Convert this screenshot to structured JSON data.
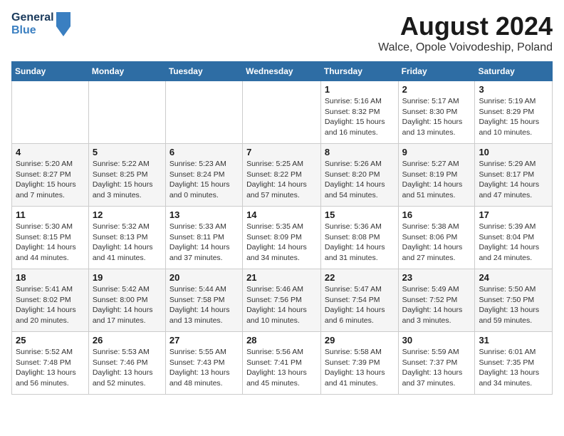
{
  "header": {
    "logo_line1": "General",
    "logo_line2": "Blue",
    "title": "August 2024",
    "subtitle": "Walce, Opole Voivodeship, Poland"
  },
  "weekdays": [
    "Sunday",
    "Monday",
    "Tuesday",
    "Wednesday",
    "Thursday",
    "Friday",
    "Saturday"
  ],
  "weeks": [
    [
      {
        "day": "",
        "info": ""
      },
      {
        "day": "",
        "info": ""
      },
      {
        "day": "",
        "info": ""
      },
      {
        "day": "",
        "info": ""
      },
      {
        "day": "1",
        "info": "Sunrise: 5:16 AM\nSunset: 8:32 PM\nDaylight: 15 hours\nand 16 minutes."
      },
      {
        "day": "2",
        "info": "Sunrise: 5:17 AM\nSunset: 8:30 PM\nDaylight: 15 hours\nand 13 minutes."
      },
      {
        "day": "3",
        "info": "Sunrise: 5:19 AM\nSunset: 8:29 PM\nDaylight: 15 hours\nand 10 minutes."
      }
    ],
    [
      {
        "day": "4",
        "info": "Sunrise: 5:20 AM\nSunset: 8:27 PM\nDaylight: 15 hours\nand 7 minutes."
      },
      {
        "day": "5",
        "info": "Sunrise: 5:22 AM\nSunset: 8:25 PM\nDaylight: 15 hours\nand 3 minutes."
      },
      {
        "day": "6",
        "info": "Sunrise: 5:23 AM\nSunset: 8:24 PM\nDaylight: 15 hours\nand 0 minutes."
      },
      {
        "day": "7",
        "info": "Sunrise: 5:25 AM\nSunset: 8:22 PM\nDaylight: 14 hours\nand 57 minutes."
      },
      {
        "day": "8",
        "info": "Sunrise: 5:26 AM\nSunset: 8:20 PM\nDaylight: 14 hours\nand 54 minutes."
      },
      {
        "day": "9",
        "info": "Sunrise: 5:27 AM\nSunset: 8:19 PM\nDaylight: 14 hours\nand 51 minutes."
      },
      {
        "day": "10",
        "info": "Sunrise: 5:29 AM\nSunset: 8:17 PM\nDaylight: 14 hours\nand 47 minutes."
      }
    ],
    [
      {
        "day": "11",
        "info": "Sunrise: 5:30 AM\nSunset: 8:15 PM\nDaylight: 14 hours\nand 44 minutes."
      },
      {
        "day": "12",
        "info": "Sunrise: 5:32 AM\nSunset: 8:13 PM\nDaylight: 14 hours\nand 41 minutes."
      },
      {
        "day": "13",
        "info": "Sunrise: 5:33 AM\nSunset: 8:11 PM\nDaylight: 14 hours\nand 37 minutes."
      },
      {
        "day": "14",
        "info": "Sunrise: 5:35 AM\nSunset: 8:09 PM\nDaylight: 14 hours\nand 34 minutes."
      },
      {
        "day": "15",
        "info": "Sunrise: 5:36 AM\nSunset: 8:08 PM\nDaylight: 14 hours\nand 31 minutes."
      },
      {
        "day": "16",
        "info": "Sunrise: 5:38 AM\nSunset: 8:06 PM\nDaylight: 14 hours\nand 27 minutes."
      },
      {
        "day": "17",
        "info": "Sunrise: 5:39 AM\nSunset: 8:04 PM\nDaylight: 14 hours\nand 24 minutes."
      }
    ],
    [
      {
        "day": "18",
        "info": "Sunrise: 5:41 AM\nSunset: 8:02 PM\nDaylight: 14 hours\nand 20 minutes."
      },
      {
        "day": "19",
        "info": "Sunrise: 5:42 AM\nSunset: 8:00 PM\nDaylight: 14 hours\nand 17 minutes."
      },
      {
        "day": "20",
        "info": "Sunrise: 5:44 AM\nSunset: 7:58 PM\nDaylight: 14 hours\nand 13 minutes."
      },
      {
        "day": "21",
        "info": "Sunrise: 5:46 AM\nSunset: 7:56 PM\nDaylight: 14 hours\nand 10 minutes."
      },
      {
        "day": "22",
        "info": "Sunrise: 5:47 AM\nSunset: 7:54 PM\nDaylight: 14 hours\nand 6 minutes."
      },
      {
        "day": "23",
        "info": "Sunrise: 5:49 AM\nSunset: 7:52 PM\nDaylight: 14 hours\nand 3 minutes."
      },
      {
        "day": "24",
        "info": "Sunrise: 5:50 AM\nSunset: 7:50 PM\nDaylight: 13 hours\nand 59 minutes."
      }
    ],
    [
      {
        "day": "25",
        "info": "Sunrise: 5:52 AM\nSunset: 7:48 PM\nDaylight: 13 hours\nand 56 minutes."
      },
      {
        "day": "26",
        "info": "Sunrise: 5:53 AM\nSunset: 7:46 PM\nDaylight: 13 hours\nand 52 minutes."
      },
      {
        "day": "27",
        "info": "Sunrise: 5:55 AM\nSunset: 7:43 PM\nDaylight: 13 hours\nand 48 minutes."
      },
      {
        "day": "28",
        "info": "Sunrise: 5:56 AM\nSunset: 7:41 PM\nDaylight: 13 hours\nand 45 minutes."
      },
      {
        "day": "29",
        "info": "Sunrise: 5:58 AM\nSunset: 7:39 PM\nDaylight: 13 hours\nand 41 minutes."
      },
      {
        "day": "30",
        "info": "Sunrise: 5:59 AM\nSunset: 7:37 PM\nDaylight: 13 hours\nand 37 minutes."
      },
      {
        "day": "31",
        "info": "Sunrise: 6:01 AM\nSunset: 7:35 PM\nDaylight: 13 hours\nand 34 minutes."
      }
    ]
  ]
}
